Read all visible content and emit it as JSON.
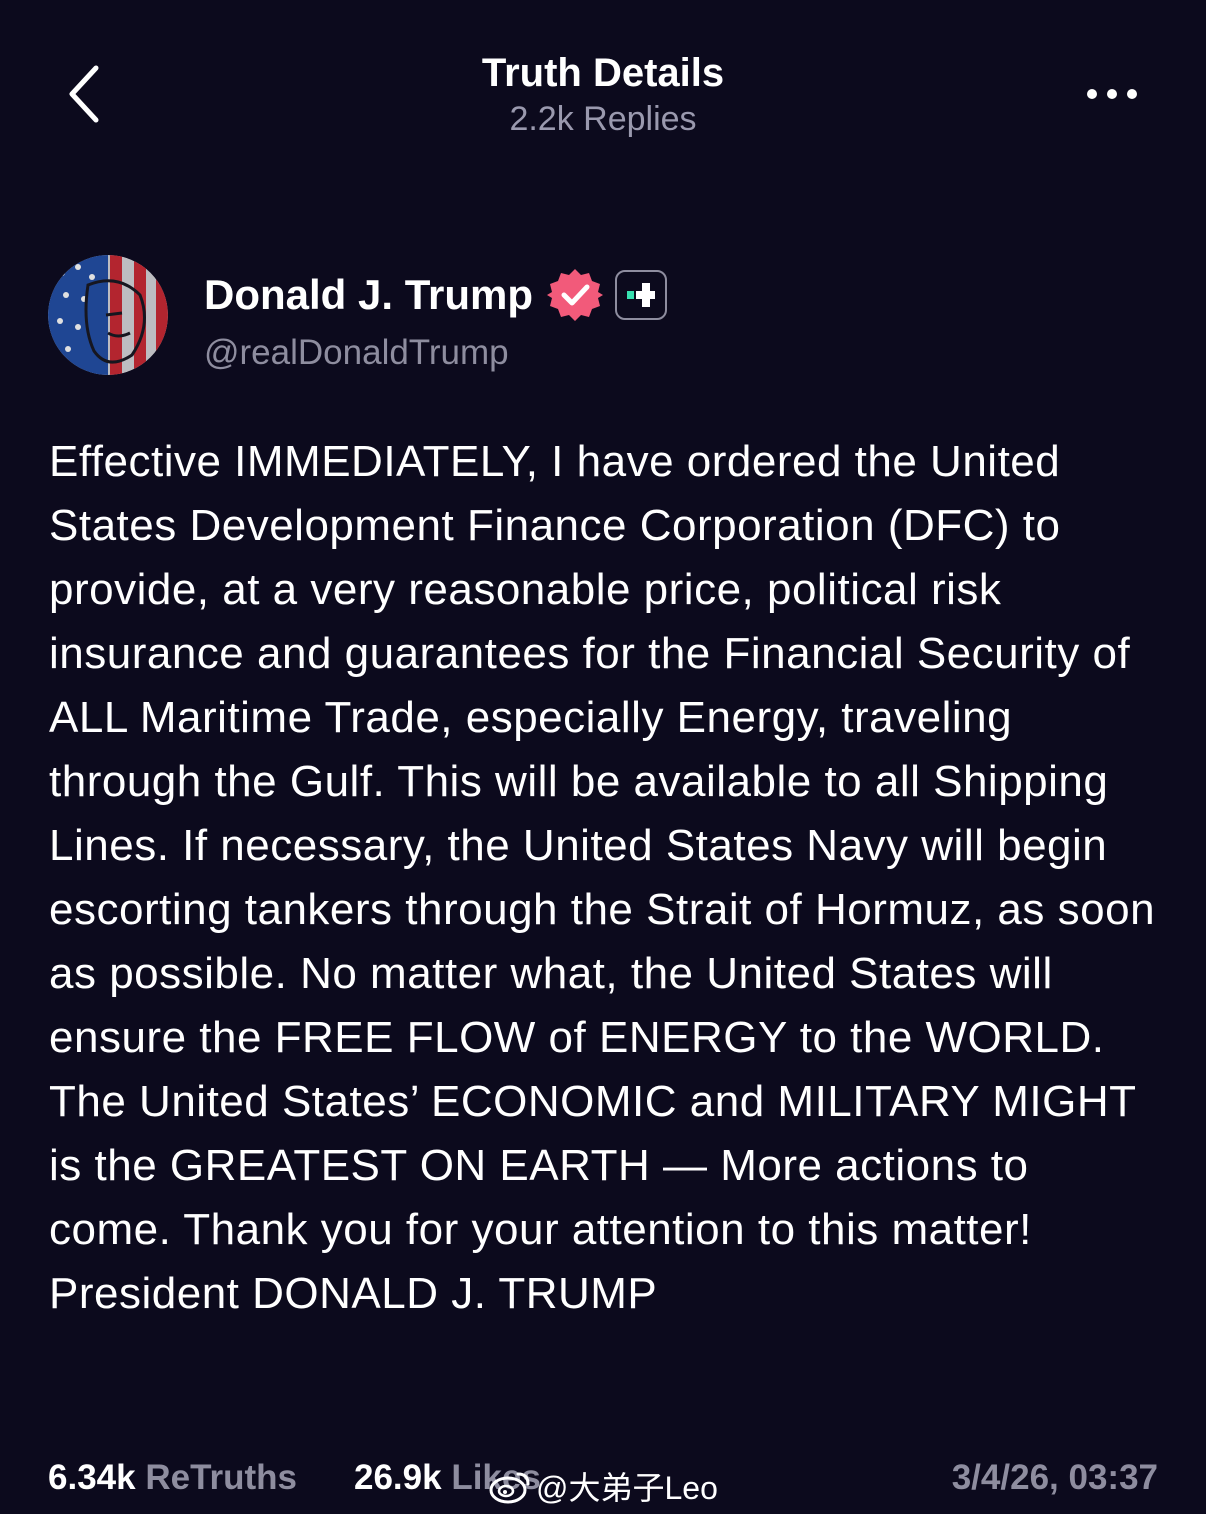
{
  "header": {
    "title": "Truth Details",
    "subtitle": "2.2k Replies"
  },
  "author": {
    "name": "Donald J. Trump",
    "handle": "@realDonaldTrump"
  },
  "post": {
    "text": "Effective IMMEDIATELY, I have ordered the United States Development Finance Corporation (DFC) to provide, at a very reasonable price, political risk insurance and guarantees for the Financial Security of ALL Maritime Trade, especially Energy, traveling through the Gulf. This will be available to all Shipping Lines. If necessary, the United States Navy will begin escorting tankers through the Strait of Hormuz, as soon as possible. No matter what, the United States will ensure the FREE FLOW of ENERGY to the WORLD. The United States’ ECONOMIC and MILITARY MIGHT is the GREATEST ON EARTH — More actions to come. Thank you for your attention to this matter! President DONALD J. TRUMP"
  },
  "stats": {
    "retruths_count": "6.34k",
    "retruths_label": "ReTruths",
    "likes_count": "26.9k",
    "likes_label": "Likes",
    "timestamp": "3/4/26, 03:37"
  },
  "watermark": {
    "text": "@大弟子Leo"
  },
  "colors": {
    "background": "#0c0a1d",
    "muted_text": "#8e8d9f",
    "verified_badge": "#f25a7a",
    "plus_accent": "#38e0b0"
  },
  "icons": {
    "back": "chevron-left-icon",
    "more": "more-horizontal-icon",
    "verified": "verified-badge-icon",
    "plus": "truth-plus-icon",
    "watermark": "weibo-icon"
  }
}
